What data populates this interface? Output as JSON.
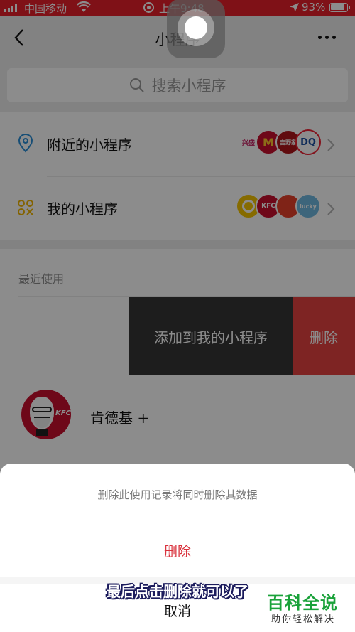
{
  "status_bar": {
    "carrier": "中国移动",
    "time": "上午9:48",
    "battery": "93%"
  },
  "nav": {
    "title": "小程序",
    "back_icon": "chevron-left-icon",
    "more_icon": "more-dots-icon"
  },
  "search": {
    "placeholder": "搜索小程序"
  },
  "menu": {
    "nearby": {
      "label": "附近的小程序",
      "icon": "location-pin-icon",
      "logo_texts": [
        "兴盛",
        "M",
        "吉野家",
        "DQ"
      ]
    },
    "mine": {
      "label": "我的小程序",
      "icon": "four-circles-icon",
      "logo_texts": [
        "",
        "KFC",
        "",
        "lucky"
      ]
    }
  },
  "recent": {
    "section_title": "最近使用",
    "swipe_add": "添加到我的小程序",
    "swipe_delete": "删除",
    "kfc_logo_text": "KFC",
    "kfc_name": "肯德基 +"
  },
  "action_sheet": {
    "message": "删除此使用记录将同时删除其数据",
    "delete": "删除",
    "cancel": "取消"
  },
  "caption": "最后点击删除就可以了",
  "watermark": {
    "title": "百科全说",
    "subtitle": "助你轻松解决"
  },
  "colors": {
    "status_bar": "#e8202a",
    "danger": "#e64340",
    "watermark": "#1aa23a"
  }
}
